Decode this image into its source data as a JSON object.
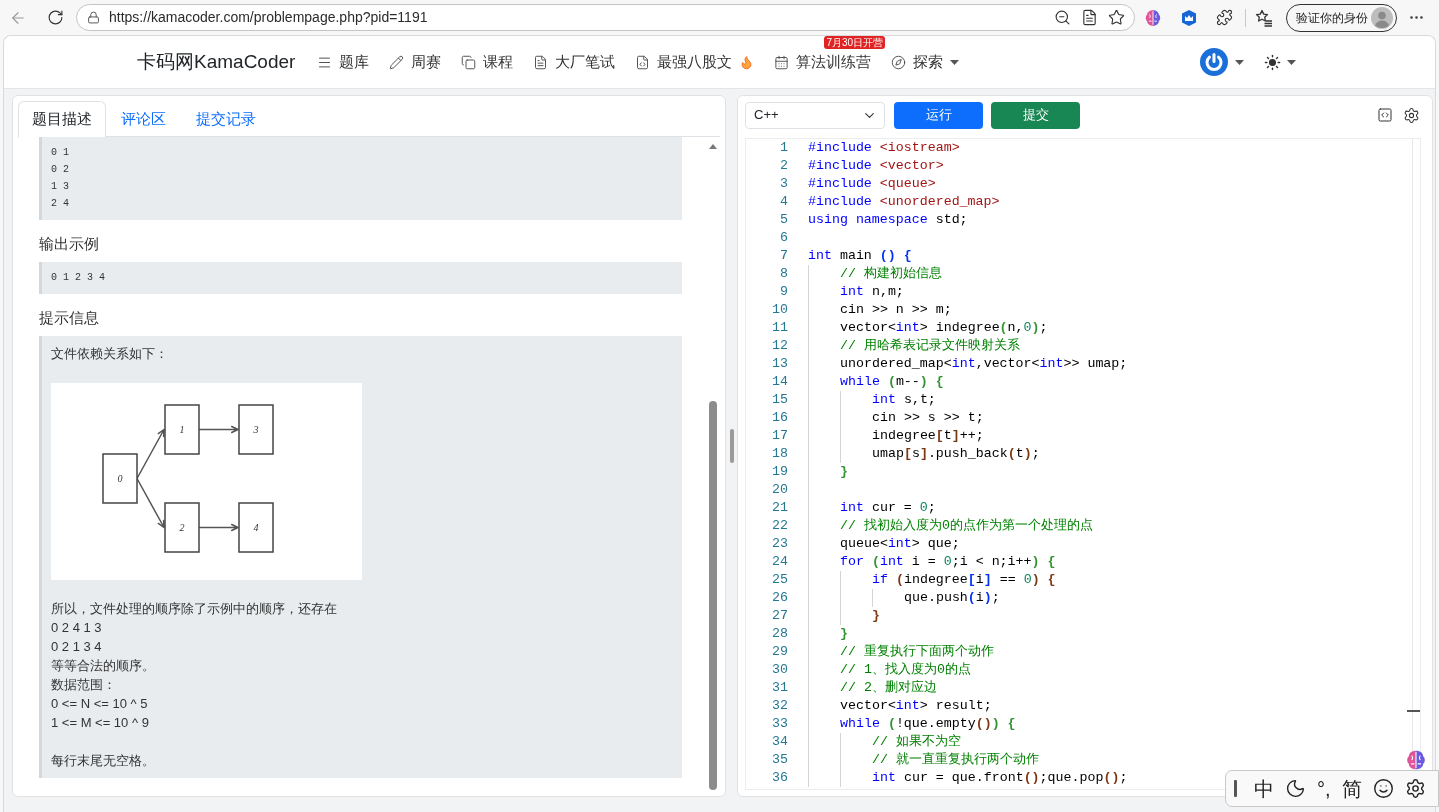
{
  "browser": {
    "url": "https://kamacoder.com/problempage.php?pid=1191",
    "profile_label": "验证你的身份"
  },
  "navbar": {
    "brand": "卡码网KamaCoder",
    "items": [
      {
        "kind": "list",
        "label": "题库"
      },
      {
        "kind": "pencil",
        "label": "周赛"
      },
      {
        "kind": "copy",
        "label": "课程"
      },
      {
        "kind": "document",
        "label": "大厂笔试"
      },
      {
        "kind": "code",
        "label": "最强八股文",
        "suffix_icon": {
          "kind": "flame"
        }
      },
      {
        "kind": "calendar",
        "label": "算法训练营",
        "badge": "7月30日开营"
      },
      {
        "kind": "compass",
        "label": "探索",
        "suffix_icon": {
          "kind": "caret"
        }
      }
    ]
  },
  "problem_panel": {
    "tabs": [
      {
        "label": "题目描述",
        "selected": true
      },
      {
        "label": "评论区",
        "selected": false
      },
      {
        "label": "提交记录",
        "selected": false
      }
    ],
    "sections": [
      {
        "kind": "sample",
        "lines": [
          "0 1",
          "0 2",
          "1 3",
          "2 4"
        ]
      },
      {
        "kind": "heading",
        "text": "输出示例"
      },
      {
        "kind": "sample",
        "lines": [
          "0 1 2 3 4"
        ]
      },
      {
        "kind": "heading",
        "text": "提示信息"
      },
      {
        "kind": "hint",
        "intro": "文件依赖关系如下：",
        "figure": {
          "nodes": [
            {
              "label": "0",
              "children": [
                {
                  "label": "1",
                  "children": [
                    {
                      "label": "3"
                    }
                  ]
                },
                {
                  "label": "2",
                  "children": [
                    {
                      "label": "4"
                    }
                  ]
                }
              ]
            }
          ]
        },
        "paragraphs": [
          [
            "所以，文件处理的顺序除了示例中的顺序，还存在",
            "0 2 4 1 3",
            "0 2 1 3 4",
            "等等合法的顺序。",
            "数据范围：",
            "0 <= N <= 10 ^ 5",
            "1 <= M <= 10 ^ 9"
          ],
          [
            "每行末尾无空格。"
          ]
        ]
      }
    ]
  },
  "editor_panel": {
    "language": "C++",
    "buttons": [
      {
        "kind": "run",
        "label": "运行"
      },
      {
        "kind": "submit",
        "label": "提交"
      }
    ],
    "code": [
      {
        "number": "1",
        "tokens": [
          {
            "kind": "keyword",
            "text": "#include "
          },
          {
            "kind": "string",
            "text": "<iostream>"
          }
        ]
      },
      {
        "number": "2",
        "tokens": [
          {
            "kind": "keyword",
            "text": "#include "
          },
          {
            "kind": "string",
            "text": "<vector>"
          }
        ]
      },
      {
        "number": "3",
        "tokens": [
          {
            "kind": "keyword",
            "text": "#include "
          },
          {
            "kind": "string",
            "text": "<queue>"
          }
        ]
      },
      {
        "number": "4",
        "tokens": [
          {
            "kind": "keyword",
            "text": "#include "
          },
          {
            "kind": "string",
            "text": "<unordered_map>"
          }
        ]
      },
      {
        "number": "5",
        "tokens": [
          {
            "kind": "keyword",
            "text": "using namespace "
          },
          {
            "kind": "plain",
            "text": "std;"
          }
        ]
      },
      {
        "number": "6"
      },
      {
        "number": "7",
        "tokens": [
          {
            "kind": "keyword",
            "text": "int "
          },
          {
            "kind": "plain",
            "text": "main "
          },
          {
            "kind": "bracket",
            "text": "() {",
            "color": "#0431fa"
          }
        ],
        "children": [
          {
            "number": "8",
            "tokens": [
              {
                "kind": "comment",
                "text": "// 构建初始信息"
              }
            ]
          },
          {
            "number": "9",
            "tokens": [
              {
                "kind": "keyword",
                "text": "int "
              },
              {
                "kind": "plain",
                "text": "n,m;"
              }
            ]
          },
          {
            "number": "10",
            "tokens": [
              {
                "kind": "plain",
                "text": "cin >> n >> m;"
              }
            ]
          },
          {
            "number": "11",
            "tokens": [
              {
                "kind": "plain",
                "text": "vector<"
              },
              {
                "kind": "keyword",
                "text": "int"
              },
              {
                "kind": "plain",
                "text": "> indegree"
              },
              {
                "kind": "bracket",
                "text": "(",
                "color": "#319331"
              },
              {
                "kind": "plain",
                "text": "n,"
              },
              {
                "kind": "number",
                "text": "0"
              },
              {
                "kind": "bracket",
                "text": ")",
                "color": "#319331"
              },
              {
                "kind": "plain",
                "text": ";"
              }
            ]
          },
          {
            "number": "12",
            "tokens": [
              {
                "kind": "comment",
                "text": "// 用哈希表记录文件映射关系"
              }
            ]
          },
          {
            "number": "13",
            "tokens": [
              {
                "kind": "plain",
                "text": "unordered_map<"
              },
              {
                "kind": "keyword",
                "text": "int"
              },
              {
                "kind": "plain",
                "text": ",vector<"
              },
              {
                "kind": "keyword",
                "text": "int"
              },
              {
                "kind": "plain",
                "text": ">> umap;"
              }
            ]
          },
          {
            "number": "14",
            "tokens": [
              {
                "kind": "keyword",
                "text": "while "
              },
              {
                "kind": "bracket",
                "text": "(",
                "color": "#319331"
              },
              {
                "kind": "plain",
                "text": "m--"
              },
              {
                "kind": "bracket",
                "text": ") {",
                "color": "#319331"
              }
            ],
            "children": [
              {
                "number": "15",
                "tokens": [
                  {
                    "kind": "keyword",
                    "text": "int "
                  },
                  {
                    "kind": "plain",
                    "text": "s,t;"
                  }
                ]
              },
              {
                "number": "16",
                "tokens": [
                  {
                    "kind": "plain",
                    "text": "cin >> s >> t;"
                  }
                ]
              },
              {
                "number": "17",
                "tokens": [
                  {
                    "kind": "plain",
                    "text": "indegree"
                  },
                  {
                    "kind": "bracket",
                    "text": "[",
                    "color": "#7b3814"
                  },
                  {
                    "kind": "plain",
                    "text": "t"
                  },
                  {
                    "kind": "bracket",
                    "text": "]",
                    "color": "#7b3814"
                  },
                  {
                    "kind": "plain",
                    "text": "++;"
                  }
                ]
              },
              {
                "number": "18",
                "tokens": [
                  {
                    "kind": "plain",
                    "text": "umap"
                  },
                  {
                    "kind": "bracket",
                    "text": "[",
                    "color": "#7b3814"
                  },
                  {
                    "kind": "plain",
                    "text": "s"
                  },
                  {
                    "kind": "bracket",
                    "text": "]",
                    "color": "#7b3814"
                  },
                  {
                    "kind": "plain",
                    "text": ".push_back"
                  },
                  {
                    "kind": "bracket",
                    "text": "(",
                    "color": "#7b3814"
                  },
                  {
                    "kind": "plain",
                    "text": "t"
                  },
                  {
                    "kind": "bracket",
                    "text": ")",
                    "color": "#7b3814"
                  },
                  {
                    "kind": "plain",
                    "text": ";"
                  }
                ]
              }
            ]
          },
          {
            "number": "19",
            "tokens": [
              {
                "kind": "bracket",
                "text": "}",
                "color": "#319331"
              }
            ]
          },
          {
            "number": "20"
          },
          {
            "number": "21",
            "tokens": [
              {
                "kind": "keyword",
                "text": "int "
              },
              {
                "kind": "plain",
                "text": "cur = "
              },
              {
                "kind": "number",
                "text": "0"
              },
              {
                "kind": "plain",
                "text": ";"
              }
            ]
          },
          {
            "number": "22",
            "tokens": [
              {
                "kind": "comment",
                "text": "// 找初始入度为0的点作为第一个处理的点"
              }
            ]
          },
          {
            "number": "23",
            "tokens": [
              {
                "kind": "plain",
                "text": "queue<"
              },
              {
                "kind": "keyword",
                "text": "int"
              },
              {
                "kind": "plain",
                "text": "> que;"
              }
            ]
          },
          {
            "number": "24",
            "tokens": [
              {
                "kind": "keyword",
                "text": "for "
              },
              {
                "kind": "bracket",
                "text": "(",
                "color": "#319331"
              },
              {
                "kind": "keyword",
                "text": "int "
              },
              {
                "kind": "plain",
                "text": "i = "
              },
              {
                "kind": "number",
                "text": "0"
              },
              {
                "kind": "plain",
                "text": ";i < n;i++"
              },
              {
                "kind": "bracket",
                "text": ") {",
                "color": "#319331"
              }
            ],
            "children": [
              {
                "number": "25",
                "tokens": [
                  {
                    "kind": "keyword",
                    "text": "if "
                  },
                  {
                    "kind": "bracket",
                    "text": "(",
                    "color": "#7b3814"
                  },
                  {
                    "kind": "plain",
                    "text": "indegree"
                  },
                  {
                    "kind": "bracket",
                    "text": "[",
                    "color": "#0431fa"
                  },
                  {
                    "kind": "plain",
                    "text": "i"
                  },
                  {
                    "kind": "bracket",
                    "text": "]",
                    "color": "#0431fa"
                  },
                  {
                    "kind": "plain",
                    "text": " == "
                  },
                  {
                    "kind": "number",
                    "text": "0"
                  },
                  {
                    "kind": "bracket",
                    "text": ") {",
                    "color": "#7b3814"
                  }
                ],
                "children": [
                  {
                    "number": "26",
                    "tokens": [
                      {
                        "kind": "plain",
                        "text": "que.push"
                      },
                      {
                        "kind": "bracket",
                        "text": "(",
                        "color": "#0431fa"
                      },
                      {
                        "kind": "plain",
                        "text": "i"
                      },
                      {
                        "kind": "bracket",
                        "text": ")",
                        "color": "#0431fa"
                      },
                      {
                        "kind": "plain",
                        "text": ";"
                      }
                    ]
                  }
                ]
              },
              {
                "number": "27",
                "tokens": [
                  {
                    "kind": "bracket",
                    "text": "}",
                    "color": "#7b3814"
                  }
                ]
              }
            ]
          },
          {
            "number": "28",
            "tokens": [
              {
                "kind": "bracket",
                "text": "}",
                "color": "#319331"
              }
            ]
          },
          {
            "number": "29",
            "tokens": [
              {
                "kind": "comment",
                "text": "// 重复执行下面两个动作"
              }
            ]
          },
          {
            "number": "30",
            "tokens": [
              {
                "kind": "comment",
                "text": "// 1、找入度为0的点"
              }
            ]
          },
          {
            "number": "31",
            "tokens": [
              {
                "kind": "comment",
                "text": "// 2、删对应边"
              }
            ]
          },
          {
            "number": "32",
            "tokens": [
              {
                "kind": "plain",
                "text": "vector<"
              },
              {
                "kind": "keyword",
                "text": "int"
              },
              {
                "kind": "plain",
                "text": "> result;"
              }
            ]
          },
          {
            "number": "33",
            "tokens": [
              {
                "kind": "keyword",
                "text": "while "
              },
              {
                "kind": "bracket",
                "text": "(",
                "color": "#319331"
              },
              {
                "kind": "plain",
                "text": "!que.empty"
              },
              {
                "kind": "bracket",
                "text": "()",
                "color": "#7b3814"
              },
              {
                "kind": "bracket",
                "text": ") {",
                "color": "#319331"
              }
            ],
            "children": [
              {
                "number": "34",
                "tokens": [
                  {
                    "kind": "comment",
                    "text": "// 如果不为空"
                  }
                ]
              },
              {
                "number": "35",
                "tokens": [
                  {
                    "kind": "comment",
                    "text": "// 就一直重复执行两个动作"
                  }
                ]
              },
              {
                "number": "36",
                "tokens": [
                  {
                    "kind": "keyword",
                    "text": "int "
                  },
                  {
                    "kind": "plain",
                    "text": "cur = que.front"
                  },
                  {
                    "kind": "bracket",
                    "text": "()",
                    "color": "#7b3814"
                  },
                  {
                    "kind": "plain",
                    "text": ";que.pop"
                  },
                  {
                    "kind": "bracket",
                    "text": "()",
                    "color": "#7b3814"
                  },
                  {
                    "kind": "plain",
                    "text": ";"
                  }
                ]
              }
            ]
          }
        ]
      }
    ]
  },
  "ime_toolbar": {
    "items": [
      {
        "kind": "text",
        "label": "中"
      },
      {
        "kind": "moon"
      },
      {
        "kind": "text",
        "label": "°,"
      },
      {
        "kind": "text",
        "label": "简"
      },
      {
        "kind": "smiley"
      },
      {
        "kind": "settings"
      }
    ]
  }
}
